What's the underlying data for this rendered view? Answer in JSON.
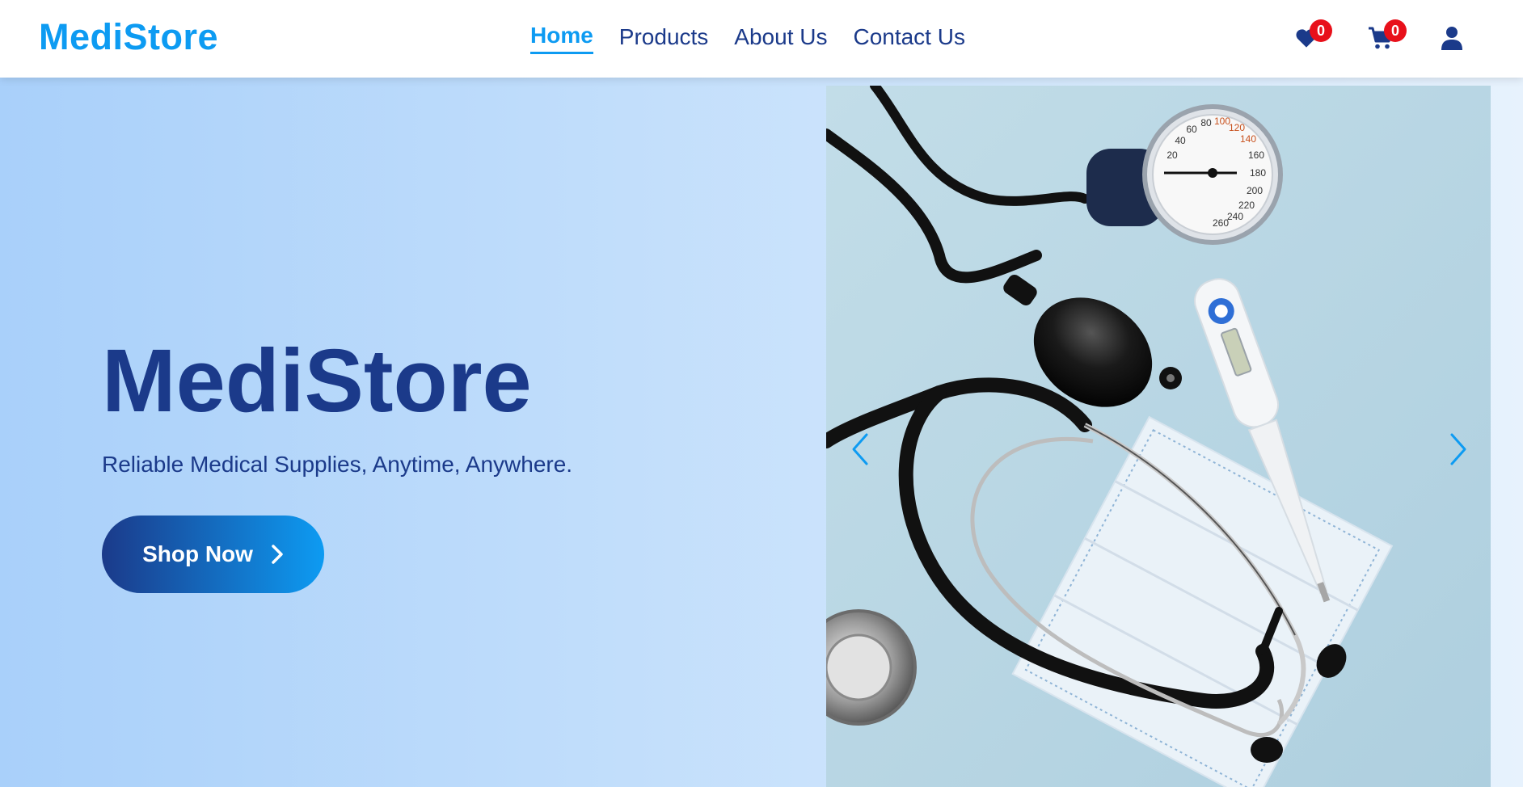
{
  "header": {
    "brand": "MediStore",
    "nav": [
      {
        "label": "Home",
        "active": true
      },
      {
        "label": "Products",
        "active": false
      },
      {
        "label": "About Us",
        "active": false
      },
      {
        "label": "Contact Us",
        "active": false
      }
    ],
    "wishlist": {
      "icon": "heart-icon",
      "count": "0"
    },
    "cart": {
      "icon": "cart-icon",
      "count": "0"
    },
    "account": {
      "icon": "user-icon"
    }
  },
  "hero": {
    "title": "MediStore",
    "tagline": "Reliable Medical Supplies, Anytime, Anywhere.",
    "cta_label": "Shop Now",
    "cta_icon": "chevron-right-icon"
  },
  "carousel": {
    "prev_icon": "chevron-left-icon",
    "next_icon": "chevron-right-icon",
    "gauge_ticks": [
      "20",
      "40",
      "60",
      "80",
      "100",
      "120",
      "140",
      "160",
      "180",
      "200",
      "220",
      "240",
      "260"
    ]
  },
  "colors": {
    "brand": "#0d9bf2",
    "navy": "#1b3a8a",
    "badge": "#e8101a"
  }
}
